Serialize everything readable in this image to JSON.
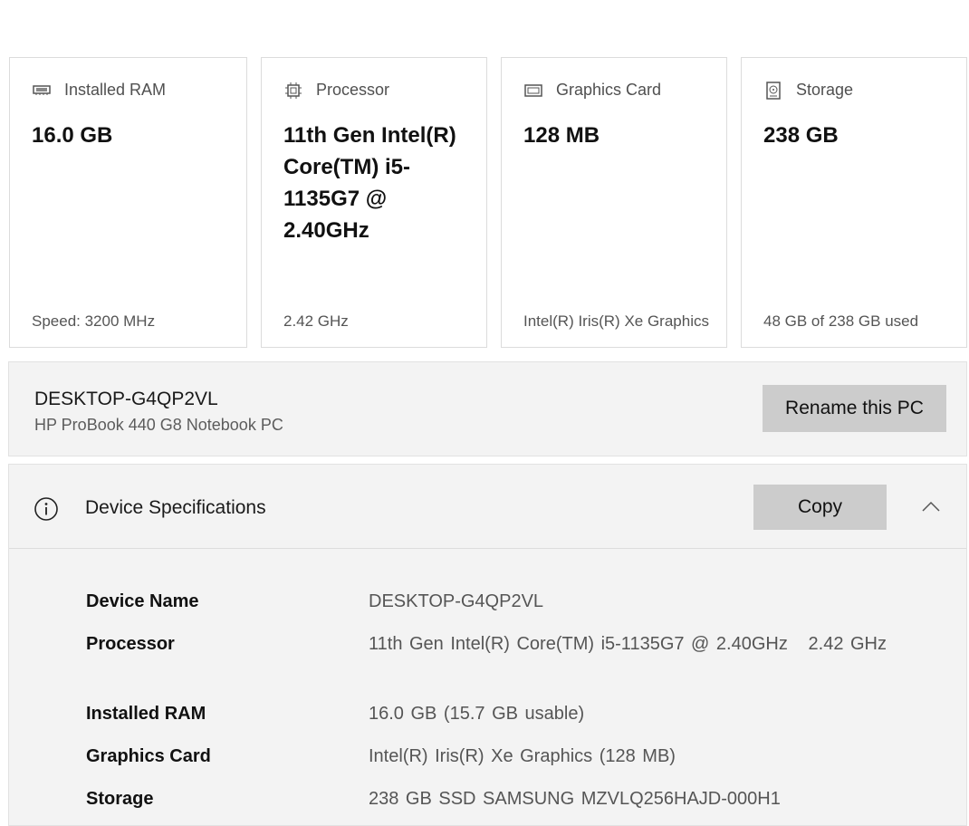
{
  "cards": [
    {
      "icon": "ram-icon",
      "label": "Installed RAM",
      "value": "16.0 GB",
      "sub": "Speed: 3200 MHz"
    },
    {
      "icon": "processor-icon",
      "label": "Processor",
      "value": "11th Gen Intel(R) Core(TM) i5-1135G7 @ 2.40GHz",
      "sub": "2.42 GHz"
    },
    {
      "icon": "graphics-card-icon",
      "label": "Graphics Card",
      "value": "128 MB",
      "sub": "Intel(R) Iris(R) Xe Graphics"
    },
    {
      "icon": "storage-icon",
      "label": "Storage",
      "value": "238 GB",
      "sub": "48 GB of 238 GB used"
    }
  ],
  "pc": {
    "name": "DESKTOP-G4QP2VL",
    "model": "HP ProBook 440 G8 Notebook PC",
    "rename_label": "Rename this PC"
  },
  "specs": {
    "title": "Device Specifications",
    "copy_label": "Copy",
    "expanded": true,
    "rows": [
      {
        "key": "Device Name",
        "value": "DESKTOP-G4QP2VL"
      },
      {
        "key": "Processor",
        "value": "11th Gen Intel(R) Core(TM) i5-1135G7 @ 2.40GHz   2.42 GHz"
      },
      {
        "key": "Installed RAM",
        "value": "16.0 GB (15.7 GB usable)"
      },
      {
        "key": "Graphics Card",
        "value": "Intel(R) Iris(R) Xe Graphics (128 MB)"
      },
      {
        "key": "Storage",
        "value": "238 GB SSD SAMSUNG MZVLQ256HAJD-000H1"
      }
    ]
  }
}
